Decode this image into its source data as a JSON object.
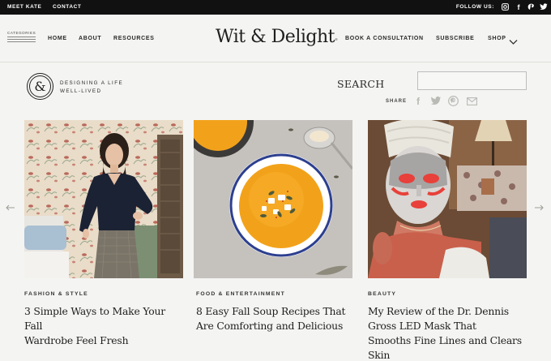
{
  "topbar": {
    "meet_label": "MEET KATE",
    "contact_label": "CONTACT",
    "follow_label": "FOLLOW US:",
    "social_icons": [
      "instagram-icon",
      "facebook-icon",
      "pinterest-icon",
      "twitter-icon"
    ]
  },
  "nav": {
    "categories_label": "CATEGORIES",
    "left_links": [
      "HOME",
      "ABOUT",
      "RESOURCES"
    ],
    "logo": "Wit & Delight",
    "right_links": [
      "BOOK A CONSULTATION",
      "SUBSCRIBE",
      "SHOP"
    ]
  },
  "tagline": {
    "badge_glyph": "&",
    "line1": "DESIGNING A LIFE",
    "line2": "WELL-LIVED"
  },
  "search": {
    "label": "SEARCH",
    "placeholder": "",
    "value": ""
  },
  "share": {
    "label": "SHARE",
    "icons": [
      "facebook-icon",
      "twitter-icon",
      "pinterest-icon",
      "email-icon"
    ]
  },
  "cards": [
    {
      "category": "FASHION & STYLE",
      "title_line1": "3 Simple Ways to Make Your Fall",
      "title_line2": "Wardrobe Feel Fresh"
    },
    {
      "category": "FOOD & ENTERTAINMENT",
      "title_line1": "8 Easy Fall Soup Recipes That",
      "title_line2": "Are Comforting and Delicious"
    },
    {
      "category": "BEAUTY",
      "title_line1": "My Review of the Dr. Dennis",
      "title_line2": "Gross LED Mask That",
      "title_line3": "Smooths Fine Lines and Clears",
      "title_line4": "Skin"
    }
  ],
  "colors": {
    "topbar": "#111111",
    "background": "#f4f4f2",
    "soup": "#f2a21a",
    "led_red": "#e8403a"
  }
}
